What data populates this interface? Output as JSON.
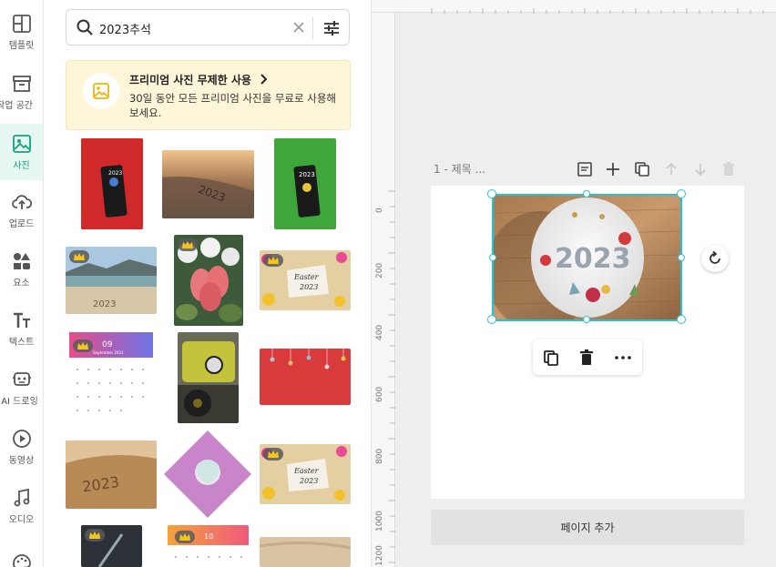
{
  "sidebar": {
    "items": [
      {
        "label": "템플릿",
        "icon": "template-icon"
      },
      {
        "label": "작업 공간",
        "icon": "workspace-icon"
      },
      {
        "label": "사진",
        "icon": "photo-icon"
      },
      {
        "label": "업로드",
        "icon": "upload-icon"
      },
      {
        "label": "요소",
        "icon": "elements-icon"
      },
      {
        "label": "텍스트",
        "icon": "text-icon"
      },
      {
        "label": "AI 드로잉",
        "icon": "ai-drawing-icon"
      },
      {
        "label": "동영상",
        "icon": "video-icon"
      },
      {
        "label": "오디오",
        "icon": "audio-icon"
      },
      {
        "label": "",
        "icon": "palette-icon"
      }
    ],
    "active_index": 2,
    "active_color": "#16a37f"
  },
  "search": {
    "value": "2023추석",
    "placeholder": ""
  },
  "promo": {
    "title": "프리미엄 사진 무제한 사용",
    "description": "30일 동안 모든 프리미엄 사진을 무료로 사용해 보세요.",
    "background": "#fff6d9"
  },
  "thumbnails": {
    "calendar_1_month": "09",
    "calendar_1_month_name": "September 2023",
    "calendar_2_month": "10",
    "easter_text_1": "Easter",
    "easter_text_2": "2023",
    "carved_text": "2023"
  },
  "canvas": {
    "ruler_labels": [
      "0",
      "200",
      "400",
      "600",
      "800",
      "1000",
      "1200"
    ],
    "page_title": "1 - 제목 ...",
    "cake_text": "2023",
    "selection_color": "#27c1d6",
    "add_page_label": "페이지 추가"
  }
}
